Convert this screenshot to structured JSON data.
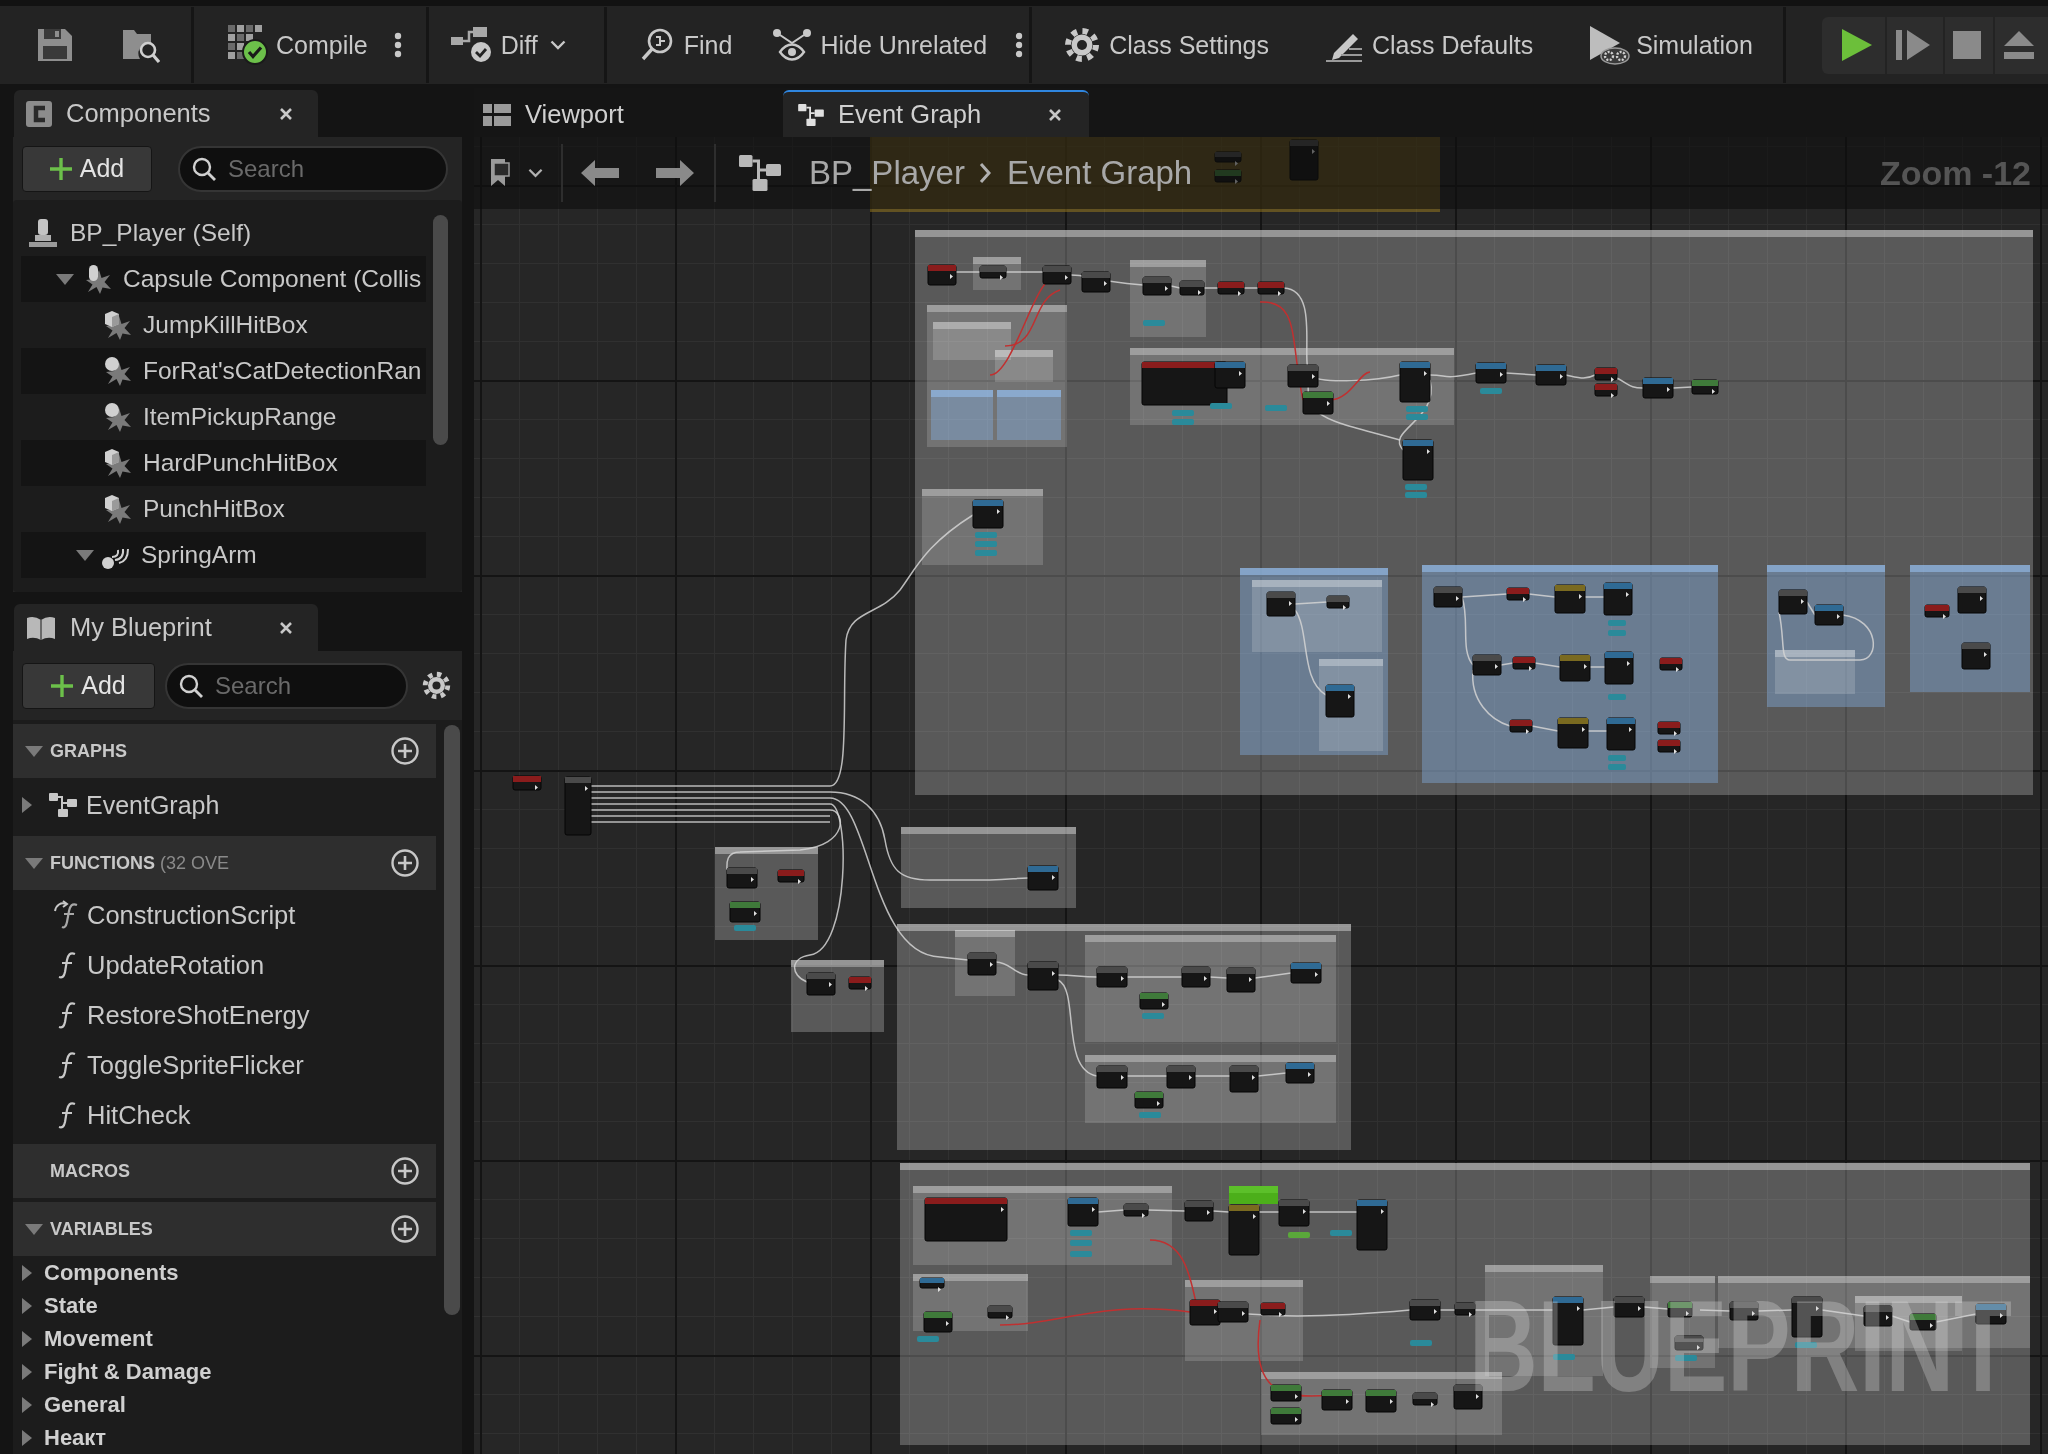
{
  "toolbar": {
    "compile": "Compile",
    "diff": "Diff",
    "find": "Find",
    "hide_unrelated": "Hide Unrelated",
    "class_settings": "Class Settings",
    "class_defaults": "Class Defaults",
    "simulation": "Simulation"
  },
  "components_panel": {
    "tab": "Components",
    "add_button": "Add",
    "search": {
      "placeholder": "Search"
    },
    "tree": [
      {
        "name": "BP_Player (Self)",
        "kind": "actor",
        "children": [
          {
            "name": "Capsule Component (Collis",
            "kind": "capsule",
            "expanded": true,
            "children": [
              {
                "name": "JumpKillHitBox",
                "kind": "box"
              },
              {
                "name": "ForRat'sCatDetectionRan",
                "kind": "sphere"
              },
              {
                "name": "ItemPickupRange",
                "kind": "sphere"
              },
              {
                "name": "HardPunchHitBox",
                "kind": "box"
              },
              {
                "name": "PunchHitBox",
                "kind": "box"
              },
              {
                "name": "SpringArm",
                "kind": "spring_arm",
                "expanded": true
              }
            ]
          }
        ]
      }
    ]
  },
  "my_blueprint": {
    "tab": "My Blueprint",
    "add_button": "Add",
    "search": {
      "placeholder": "Search"
    },
    "sections": [
      {
        "title": "GRAPHS",
        "expanded": true,
        "items": [
          {
            "name": "EventGraph",
            "kind": "graph",
            "expanded": false
          }
        ]
      },
      {
        "title": "FUNCTIONS",
        "note": "(32 OVE",
        "expanded": true,
        "items": [
          {
            "name": "ConstructionScript",
            "kind": "construction_script"
          },
          {
            "name": "UpdateRotation",
            "kind": "function"
          },
          {
            "name": "RestoreShotEnergy",
            "kind": "function"
          },
          {
            "name": "ToggleSpriteFlicker",
            "kind": "function"
          },
          {
            "name": "HitCheck",
            "kind": "function"
          }
        ]
      },
      {
        "title": "MACROS"
      },
      {
        "title": "VARIABLES",
        "expanded": true,
        "items": [
          {
            "name": "Components",
            "kind": "category",
            "expanded": false
          },
          {
            "name": "State",
            "kind": "category",
            "expanded": false
          },
          {
            "name": "Movement",
            "kind": "category",
            "expanded": false
          },
          {
            "name": "Fight & Damage",
            "kind": "category",
            "expanded": false
          },
          {
            "name": "General",
            "kind": "category",
            "expanded": false
          },
          {
            "name": "Неакт",
            "kind": "category",
            "expanded": false
          }
        ]
      }
    ]
  },
  "editor_tabs": [
    {
      "title": "Viewport",
      "kind": "viewport",
      "selected": false
    },
    {
      "title": "Event Graph",
      "kind": "graph",
      "selected": true
    }
  ],
  "graph": {
    "breadcrumb": [
      "BP_Player",
      "Event Graph"
    ],
    "zoom_label": "Zoom -12",
    "corner_label": "BLUEPRINT"
  }
}
